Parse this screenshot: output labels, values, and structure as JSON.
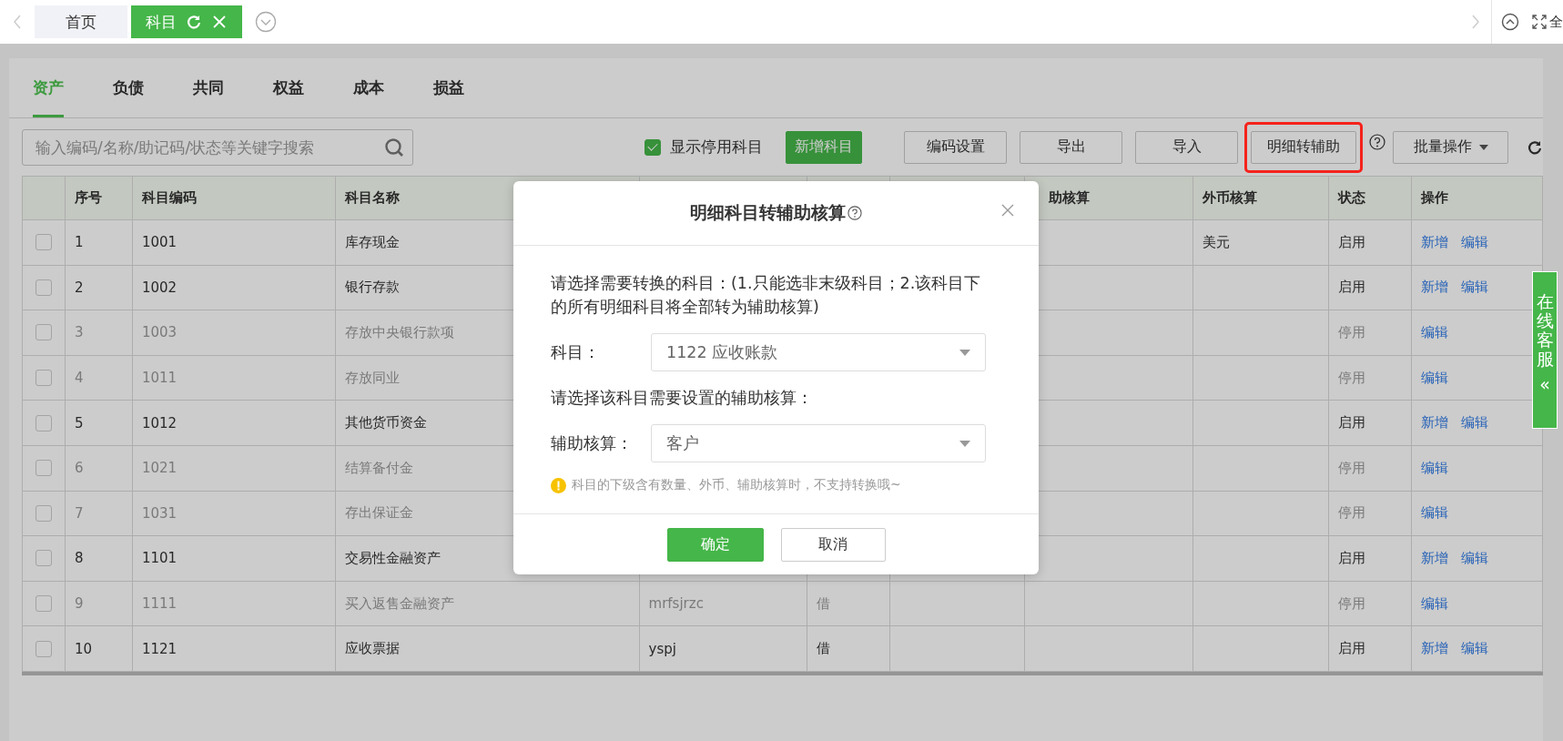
{
  "top_tabs": [
    {
      "label": "首页",
      "selected": false,
      "closable": false
    },
    {
      "label": "科目",
      "selected": true,
      "closable": true
    }
  ],
  "top_right": {
    "label": "全"
  },
  "category_tabs": [
    {
      "label": "资产",
      "selected": true
    },
    {
      "label": "负债",
      "selected": false
    },
    {
      "label": "共同",
      "selected": false
    },
    {
      "label": "权益",
      "selected": false
    },
    {
      "label": "成本",
      "selected": false
    },
    {
      "label": "损益",
      "selected": false
    }
  ],
  "search": {
    "placeholder": "输入编码/名称/助记码/状态等关键字搜索"
  },
  "show_disabled": {
    "label": "显示停用科目",
    "checked": true
  },
  "toolbar_buttons": [
    {
      "label": "新增科目",
      "kind": "primary"
    },
    {
      "label": "编码设置",
      "kind": "default"
    },
    {
      "label": "导出",
      "kind": "default"
    },
    {
      "label": "导入",
      "kind": "default"
    },
    {
      "label": "明细转辅助",
      "kind": "highlighted"
    },
    {
      "label": "批量操作",
      "kind": "dropdown"
    }
  ],
  "table": {
    "columns": [
      {
        "kind": "checkbox"
      },
      {
        "kind": "text",
        "label": "序号"
      },
      {
        "kind": "text",
        "label": "科目编码"
      },
      {
        "kind": "text",
        "label": "科目名称"
      },
      {
        "kind": "text"
      },
      {
        "kind": "text"
      },
      {
        "kind": "text"
      },
      {
        "kind": "text",
        "label": "助核算"
      },
      {
        "kind": "text",
        "label": "外币核算"
      },
      {
        "kind": "text",
        "label": "状态"
      },
      {
        "kind": "actions",
        "label": "操作"
      }
    ],
    "rows": [
      {
        "checked": false,
        "disabled": false,
        "cells": [
          "",
          "1",
          "1001",
          "库存现金",
          "",
          "",
          "",
          "",
          "美元",
          "启用"
        ],
        "actions": [
          "新增",
          "编辑"
        ]
      },
      {
        "checked": false,
        "disabled": false,
        "cells": [
          "",
          "2",
          "1002",
          "银行存款",
          "",
          "",
          "",
          "",
          "",
          "启用"
        ],
        "actions": [
          "新增",
          "编辑"
        ]
      },
      {
        "checked": false,
        "disabled": true,
        "cells": [
          "",
          "3",
          "1003",
          "存放中央银行款项",
          "",
          "",
          "",
          "",
          "",
          "停用"
        ],
        "actions": [
          "编辑"
        ]
      },
      {
        "checked": false,
        "disabled": true,
        "cells": [
          "",
          "4",
          "1011",
          "存放同业",
          "",
          "",
          "",
          "",
          "",
          "停用"
        ],
        "actions": [
          "编辑"
        ]
      },
      {
        "checked": false,
        "disabled": false,
        "cells": [
          "",
          "5",
          "1012",
          "其他货币资金",
          "",
          "",
          "",
          "",
          "",
          "启用"
        ],
        "actions": [
          "新增",
          "编辑"
        ]
      },
      {
        "checked": false,
        "disabled": true,
        "cells": [
          "",
          "6",
          "1021",
          "结算备付金",
          "",
          "",
          "",
          "",
          "",
          "停用"
        ],
        "actions": [
          "编辑"
        ]
      },
      {
        "checked": false,
        "disabled": true,
        "cells": [
          "",
          "7",
          "1031",
          "存出保证金",
          "",
          "",
          "",
          "",
          "",
          "停用"
        ],
        "actions": [
          "编辑"
        ]
      },
      {
        "checked": false,
        "disabled": false,
        "cells": [
          "",
          "8",
          "1101",
          "交易性金融资产",
          "",
          "",
          "",
          "",
          "",
          "启用"
        ],
        "actions": [
          "新增",
          "编辑"
        ]
      },
      {
        "checked": false,
        "disabled": true,
        "cells": [
          "",
          "9",
          "1111",
          "买入返售金融资产",
          "mrfsjrzc",
          "借",
          "",
          "",
          "",
          "停用"
        ],
        "actions": [
          "编辑"
        ]
      },
      {
        "checked": false,
        "disabled": false,
        "cells": [
          "",
          "10",
          "1121",
          "应收票据",
          "yspj",
          "借",
          "",
          "",
          "",
          "启用"
        ],
        "actions": [
          "新增",
          "编辑"
        ]
      }
    ]
  },
  "dialog": {
    "title": "明细科目转辅助核算",
    "body": [
      {
        "kind": "text",
        "text": "请选择需要转换的科目：(1.只能选非末级科目；2.该科目下的所有明细科目将全部转为辅助核算)"
      },
      {
        "kind": "select",
        "label": "科目：",
        "value": "1122 应收账款"
      },
      {
        "kind": "text",
        "text": "请选择该科目需要设置的辅助核算："
      },
      {
        "kind": "select",
        "label": "辅助核算：",
        "value": "客户"
      },
      {
        "kind": "warning",
        "text": "科目的下级含有数量、外币、辅助核算时，不支持转换哦~"
      }
    ],
    "buttons": [
      {
        "label": "确定",
        "kind": "primary"
      },
      {
        "label": "取消",
        "kind": "default"
      }
    ]
  },
  "float_tab": {
    "label": "在线客服",
    "arrow": "«"
  }
}
